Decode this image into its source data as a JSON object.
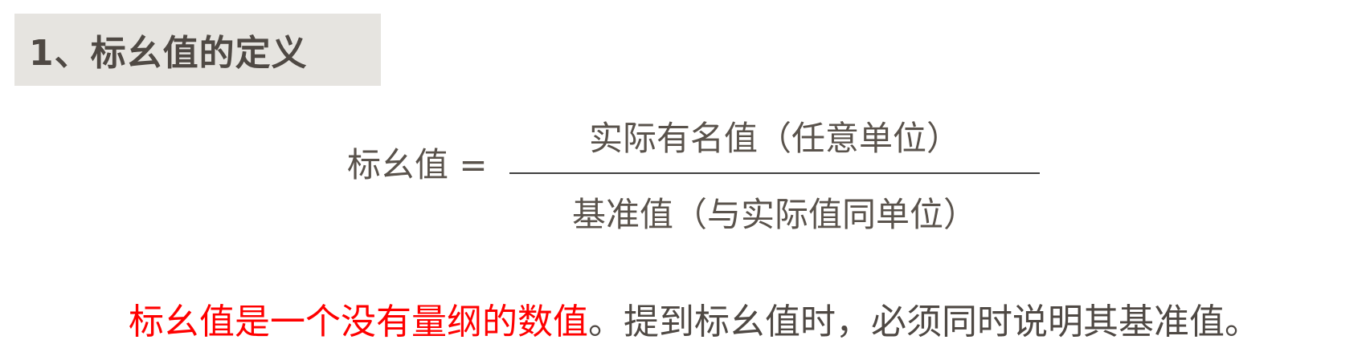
{
  "section": {
    "title": "1、标幺值的定义"
  },
  "formula": {
    "lhs": "标幺值 =",
    "numerator": "实际有名值（任意单位）",
    "denominator": "基准值（与实际值同单位）"
  },
  "statement": {
    "highlight": "标幺值是一个没有量纲的数值",
    "rest": "。提到标幺值时，必须同时说明其基准值。",
    "highlight_color": "#ff0000"
  }
}
